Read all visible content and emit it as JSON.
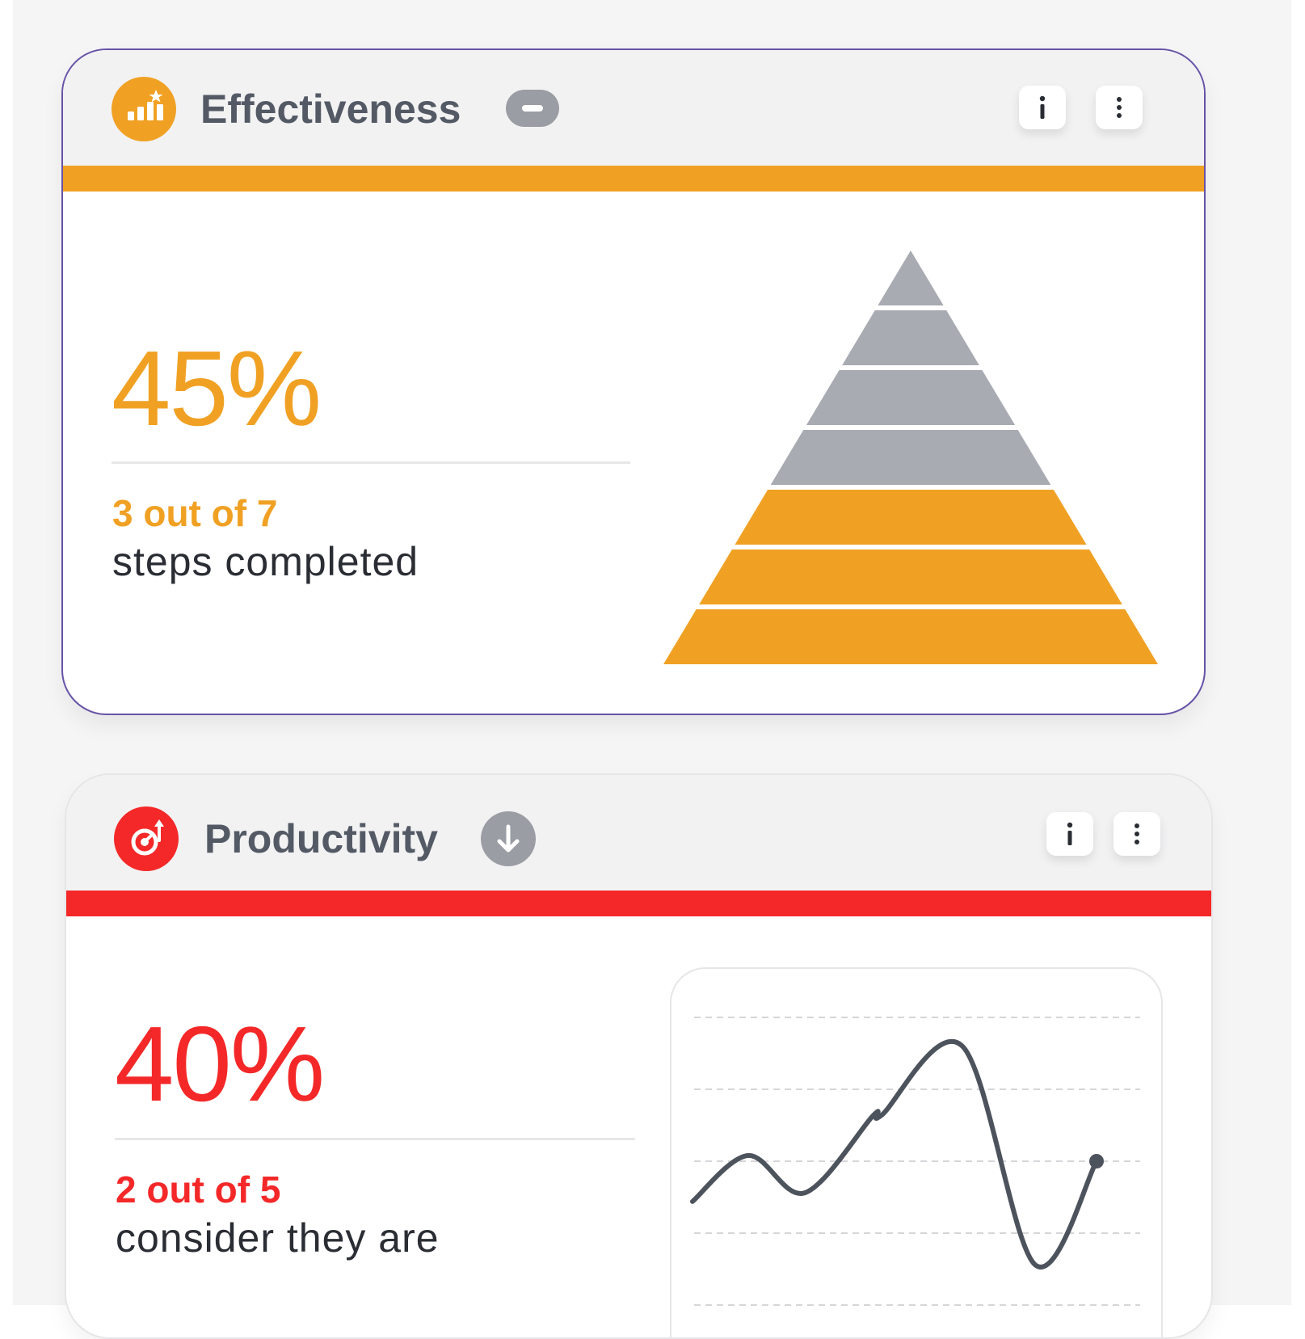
{
  "colors": {
    "effectiveness_accent": "#f0a124",
    "productivity_accent": "#f42828",
    "pyramid_inactive": "#a8abb1",
    "line_color": "#4d535c"
  },
  "effectiveness": {
    "title": "Effectiveness",
    "icon": "bar-chart-star-icon",
    "trend": "neutral",
    "trend_icon": "minus-icon",
    "info_label": "i",
    "menu_label": "⋮",
    "percentage": "45%",
    "count": "3 out of 7",
    "description": "steps completed",
    "steps_total": 7,
    "steps_completed": 3
  },
  "productivity": {
    "title": "Productivity",
    "icon": "speedometer-icon",
    "trend": "down",
    "trend_icon": "arrow-down-icon",
    "info_label": "i",
    "menu_label": "⋮",
    "percentage": "40%",
    "count": "2 out of 5",
    "description": "consider they are",
    "chart_data": {
      "type": "line",
      "values": [
        0.22,
        0.54,
        0.28,
        0.82,
        0.82,
        1.3,
        -0.22,
        0.5
      ],
      "grid": "dashed",
      "end_marker": true
    }
  }
}
